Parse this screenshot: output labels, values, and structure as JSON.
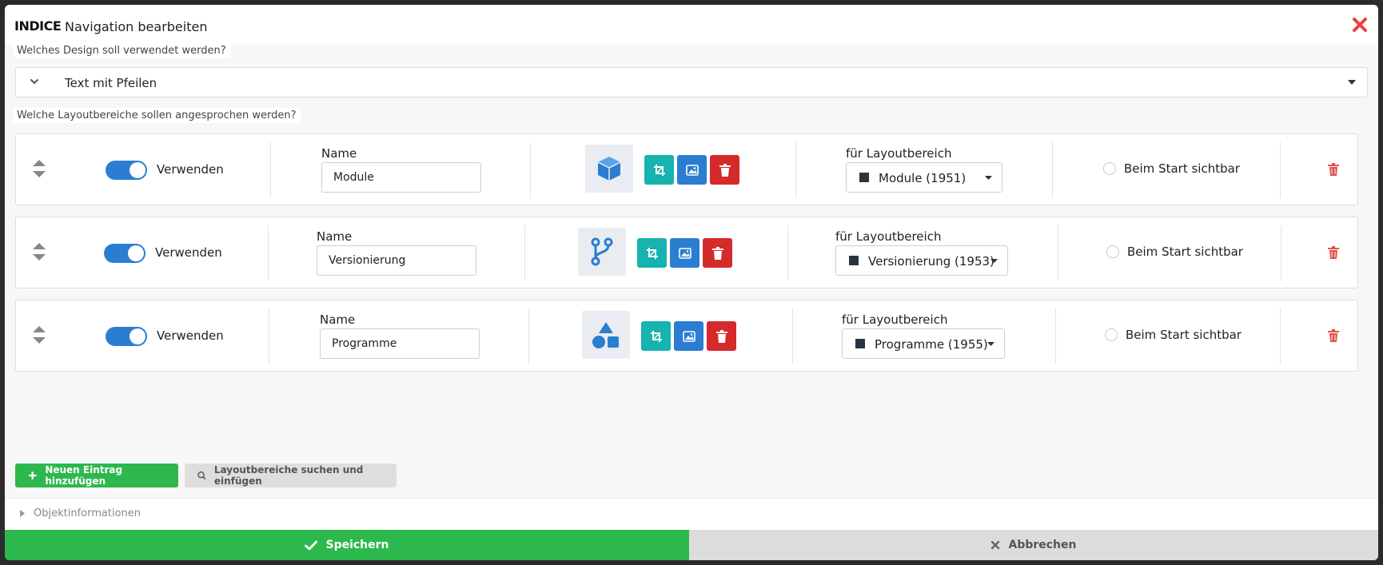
{
  "header": {
    "brand": "INDICE",
    "title": "Navigation bearbeiten"
  },
  "design": {
    "question": "Welches Design soll verwendet werden?",
    "selected": "Text mit Pfeilen"
  },
  "layout_question": "Welche Layoutbereiche sollen angesprochen werden?",
  "labels": {
    "use": "Verwenden",
    "name": "Name",
    "layout_area": "für Layoutbereich",
    "visible_on_start": "Beim Start sichtbar"
  },
  "entries": [
    {
      "name": "Module",
      "icon": "cube-icon",
      "layout_area": "Module (1951)",
      "enabled": true,
      "visible_on_start": false
    },
    {
      "name": "Versionierung",
      "icon": "branch-icon",
      "layout_area": "Versionierung (1953)",
      "enabled": true,
      "visible_on_start": false
    },
    {
      "name": "Programme",
      "icon": "shapes-icon",
      "layout_area": "Programme (1955)",
      "enabled": true,
      "visible_on_start": false
    }
  ],
  "actions": {
    "add_entry": "Neuen Eintrag hinzufügen",
    "search_layout": "Layoutbereiche suchen und einfügen"
  },
  "object_info": "Objektinformationen",
  "footer": {
    "save": "Speichern",
    "cancel": "Abbrechen"
  },
  "colors": {
    "primary_blue": "#2a7dd1",
    "teal": "#17b3b0",
    "danger_red": "#d42a2a",
    "success_green": "#2db84d",
    "close_red": "#e8413c"
  }
}
